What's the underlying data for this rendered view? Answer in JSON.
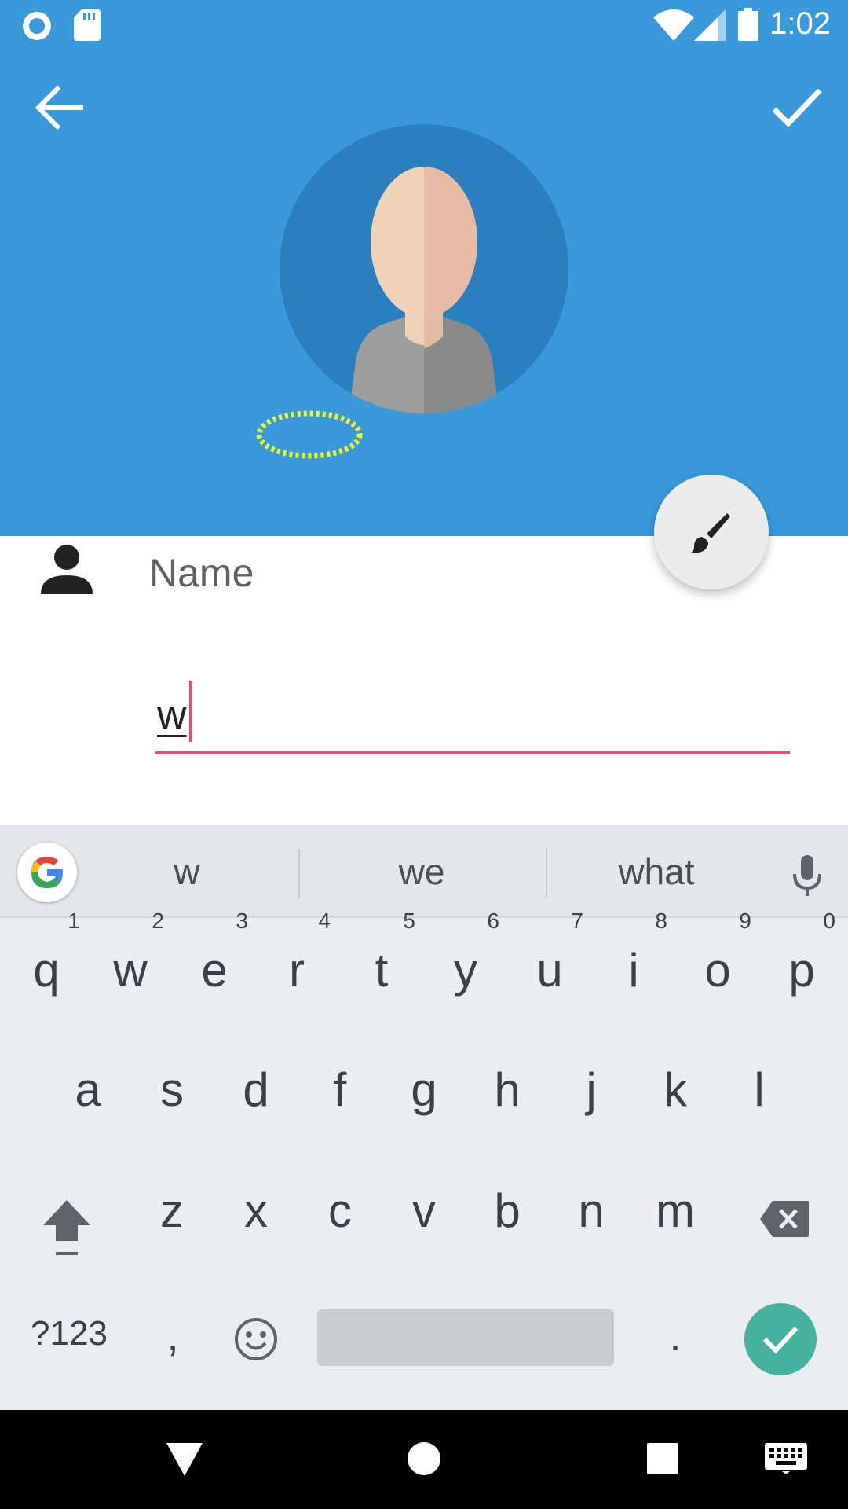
{
  "status_bar": {
    "time": "1:02",
    "left_icons": [
      "circle-icon",
      "sd-card-icon"
    ],
    "right_icons": [
      "wifi-icon",
      "signal-icon",
      "battery-icon"
    ]
  },
  "header": {
    "background": "#3999db",
    "back_icon": "arrow-left-icon",
    "confirm_icon": "check-icon"
  },
  "form": {
    "name_label": "Name",
    "name_value": "w",
    "accent": "#ea4a80"
  },
  "fab": {
    "icon": "brush-icon"
  },
  "keyboard": {
    "suggestions": [
      "w",
      "we",
      "what"
    ],
    "row1": [
      "q",
      "w",
      "e",
      "r",
      "t",
      "y",
      "u",
      "i",
      "o",
      "p"
    ],
    "row1_hints": [
      "1",
      "2",
      "3",
      "4",
      "5",
      "6",
      "7",
      "8",
      "9",
      "0"
    ],
    "row2": [
      "a",
      "s",
      "d",
      "f",
      "g",
      "h",
      "j",
      "k",
      "l"
    ],
    "row3": [
      "z",
      "x",
      "c",
      "v",
      "b",
      "n",
      "m"
    ],
    "symbols_label": "?123",
    "comma": ",",
    "period": ".",
    "enter_color": "#45b29f"
  },
  "nav": {
    "icons": [
      "back-triangle-icon",
      "home-circle-icon",
      "recents-square-icon",
      "keyboard-icon"
    ]
  }
}
